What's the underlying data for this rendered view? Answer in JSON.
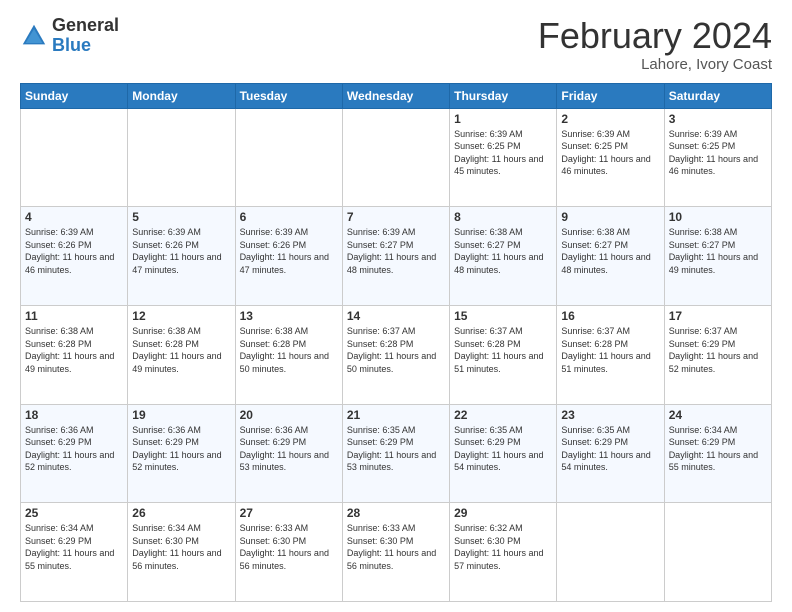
{
  "logo": {
    "general": "General",
    "blue": "Blue"
  },
  "header": {
    "month": "February 2024",
    "location": "Lahore, Ivory Coast"
  },
  "weekdays": [
    "Sunday",
    "Monday",
    "Tuesday",
    "Wednesday",
    "Thursday",
    "Friday",
    "Saturday"
  ],
  "weeks": [
    [
      {
        "day": "",
        "info": ""
      },
      {
        "day": "",
        "info": ""
      },
      {
        "day": "",
        "info": ""
      },
      {
        "day": "",
        "info": ""
      },
      {
        "day": "1",
        "info": "Sunrise: 6:39 AM\nSunset: 6:25 PM\nDaylight: 11 hours and 45 minutes."
      },
      {
        "day": "2",
        "info": "Sunrise: 6:39 AM\nSunset: 6:25 PM\nDaylight: 11 hours and 46 minutes."
      },
      {
        "day": "3",
        "info": "Sunrise: 6:39 AM\nSunset: 6:25 PM\nDaylight: 11 hours and 46 minutes."
      }
    ],
    [
      {
        "day": "4",
        "info": "Sunrise: 6:39 AM\nSunset: 6:26 PM\nDaylight: 11 hours and 46 minutes."
      },
      {
        "day": "5",
        "info": "Sunrise: 6:39 AM\nSunset: 6:26 PM\nDaylight: 11 hours and 47 minutes."
      },
      {
        "day": "6",
        "info": "Sunrise: 6:39 AM\nSunset: 6:26 PM\nDaylight: 11 hours and 47 minutes."
      },
      {
        "day": "7",
        "info": "Sunrise: 6:39 AM\nSunset: 6:27 PM\nDaylight: 11 hours and 48 minutes."
      },
      {
        "day": "8",
        "info": "Sunrise: 6:38 AM\nSunset: 6:27 PM\nDaylight: 11 hours and 48 minutes."
      },
      {
        "day": "9",
        "info": "Sunrise: 6:38 AM\nSunset: 6:27 PM\nDaylight: 11 hours and 48 minutes."
      },
      {
        "day": "10",
        "info": "Sunrise: 6:38 AM\nSunset: 6:27 PM\nDaylight: 11 hours and 49 minutes."
      }
    ],
    [
      {
        "day": "11",
        "info": "Sunrise: 6:38 AM\nSunset: 6:28 PM\nDaylight: 11 hours and 49 minutes."
      },
      {
        "day": "12",
        "info": "Sunrise: 6:38 AM\nSunset: 6:28 PM\nDaylight: 11 hours and 49 minutes."
      },
      {
        "day": "13",
        "info": "Sunrise: 6:38 AM\nSunset: 6:28 PM\nDaylight: 11 hours and 50 minutes."
      },
      {
        "day": "14",
        "info": "Sunrise: 6:37 AM\nSunset: 6:28 PM\nDaylight: 11 hours and 50 minutes."
      },
      {
        "day": "15",
        "info": "Sunrise: 6:37 AM\nSunset: 6:28 PM\nDaylight: 11 hours and 51 minutes."
      },
      {
        "day": "16",
        "info": "Sunrise: 6:37 AM\nSunset: 6:28 PM\nDaylight: 11 hours and 51 minutes."
      },
      {
        "day": "17",
        "info": "Sunrise: 6:37 AM\nSunset: 6:29 PM\nDaylight: 11 hours and 52 minutes."
      }
    ],
    [
      {
        "day": "18",
        "info": "Sunrise: 6:36 AM\nSunset: 6:29 PM\nDaylight: 11 hours and 52 minutes."
      },
      {
        "day": "19",
        "info": "Sunrise: 6:36 AM\nSunset: 6:29 PM\nDaylight: 11 hours and 52 minutes."
      },
      {
        "day": "20",
        "info": "Sunrise: 6:36 AM\nSunset: 6:29 PM\nDaylight: 11 hours and 53 minutes."
      },
      {
        "day": "21",
        "info": "Sunrise: 6:35 AM\nSunset: 6:29 PM\nDaylight: 11 hours and 53 minutes."
      },
      {
        "day": "22",
        "info": "Sunrise: 6:35 AM\nSunset: 6:29 PM\nDaylight: 11 hours and 54 minutes."
      },
      {
        "day": "23",
        "info": "Sunrise: 6:35 AM\nSunset: 6:29 PM\nDaylight: 11 hours and 54 minutes."
      },
      {
        "day": "24",
        "info": "Sunrise: 6:34 AM\nSunset: 6:29 PM\nDaylight: 11 hours and 55 minutes."
      }
    ],
    [
      {
        "day": "25",
        "info": "Sunrise: 6:34 AM\nSunset: 6:29 PM\nDaylight: 11 hours and 55 minutes."
      },
      {
        "day": "26",
        "info": "Sunrise: 6:34 AM\nSunset: 6:30 PM\nDaylight: 11 hours and 56 minutes."
      },
      {
        "day": "27",
        "info": "Sunrise: 6:33 AM\nSunset: 6:30 PM\nDaylight: 11 hours and 56 minutes."
      },
      {
        "day": "28",
        "info": "Sunrise: 6:33 AM\nSunset: 6:30 PM\nDaylight: 11 hours and 56 minutes."
      },
      {
        "day": "29",
        "info": "Sunrise: 6:32 AM\nSunset: 6:30 PM\nDaylight: 11 hours and 57 minutes."
      },
      {
        "day": "",
        "info": ""
      },
      {
        "day": "",
        "info": ""
      }
    ]
  ]
}
